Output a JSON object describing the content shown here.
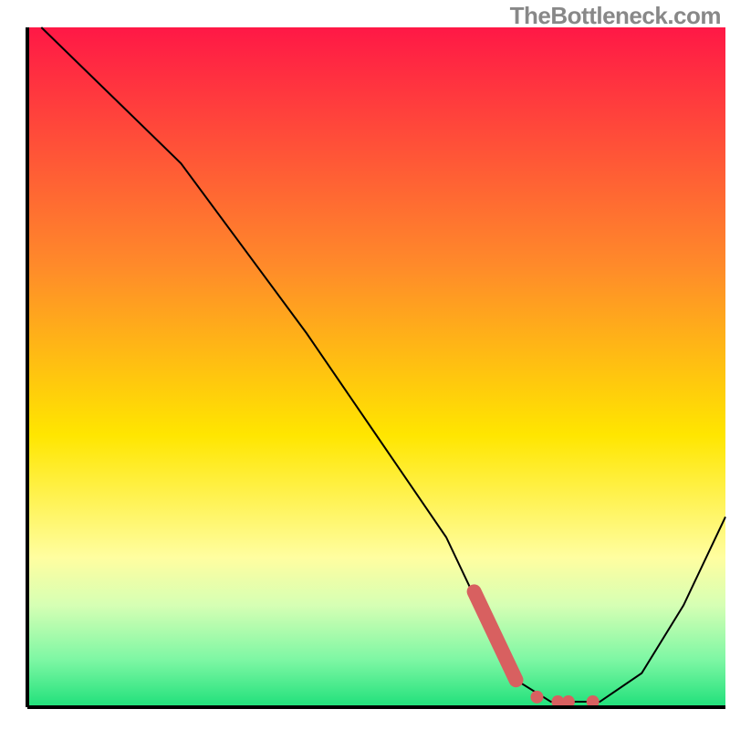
{
  "watermark": "TheBottleneck.com",
  "chart_data": {
    "type": "line",
    "title": "",
    "xlabel": "",
    "ylabel": "",
    "xlim": [
      0,
      100
    ],
    "ylim": [
      0,
      100
    ],
    "gradient_stops": [
      {
        "offset": 0,
        "color": "#ff1846"
      },
      {
        "offset": 35,
        "color": "#ff8a2a"
      },
      {
        "offset": 60,
        "color": "#ffe600"
      },
      {
        "offset": 78,
        "color": "#fffea0"
      },
      {
        "offset": 85,
        "color": "#d6ffb4"
      },
      {
        "offset": 93,
        "color": "#7ef7a4"
      },
      {
        "offset": 100,
        "color": "#1fe07a"
      }
    ],
    "series": [
      {
        "name": "curve",
        "type": "line",
        "color": "#000000",
        "points": [
          {
            "x": 2,
            "y": 100
          },
          {
            "x": 12,
            "y": 90
          },
          {
            "x": 22,
            "y": 80
          },
          {
            "x": 40,
            "y": 55
          },
          {
            "x": 50,
            "y": 40
          },
          {
            "x": 60,
            "y": 25
          },
          {
            "x": 66,
            "y": 12
          },
          {
            "x": 70,
            "y": 4
          },
          {
            "x": 75,
            "y": 0.8
          },
          {
            "x": 82,
            "y": 0.8
          },
          {
            "x": 88,
            "y": 5
          },
          {
            "x": 94,
            "y": 15
          },
          {
            "x": 100,
            "y": 28
          }
        ]
      },
      {
        "name": "highlight-stroke",
        "type": "line",
        "color": "#d86060",
        "points": [
          {
            "x": 64,
            "y": 17
          },
          {
            "x": 70,
            "y": 4
          }
        ]
      },
      {
        "name": "highlight-dots",
        "type": "scatter",
        "color": "#d86060",
        "points": [
          {
            "x": 73,
            "y": 1.5
          },
          {
            "x": 76,
            "y": 0.8
          },
          {
            "x": 77.5,
            "y": 0.8
          },
          {
            "x": 81,
            "y": 0.8
          }
        ]
      }
    ]
  }
}
